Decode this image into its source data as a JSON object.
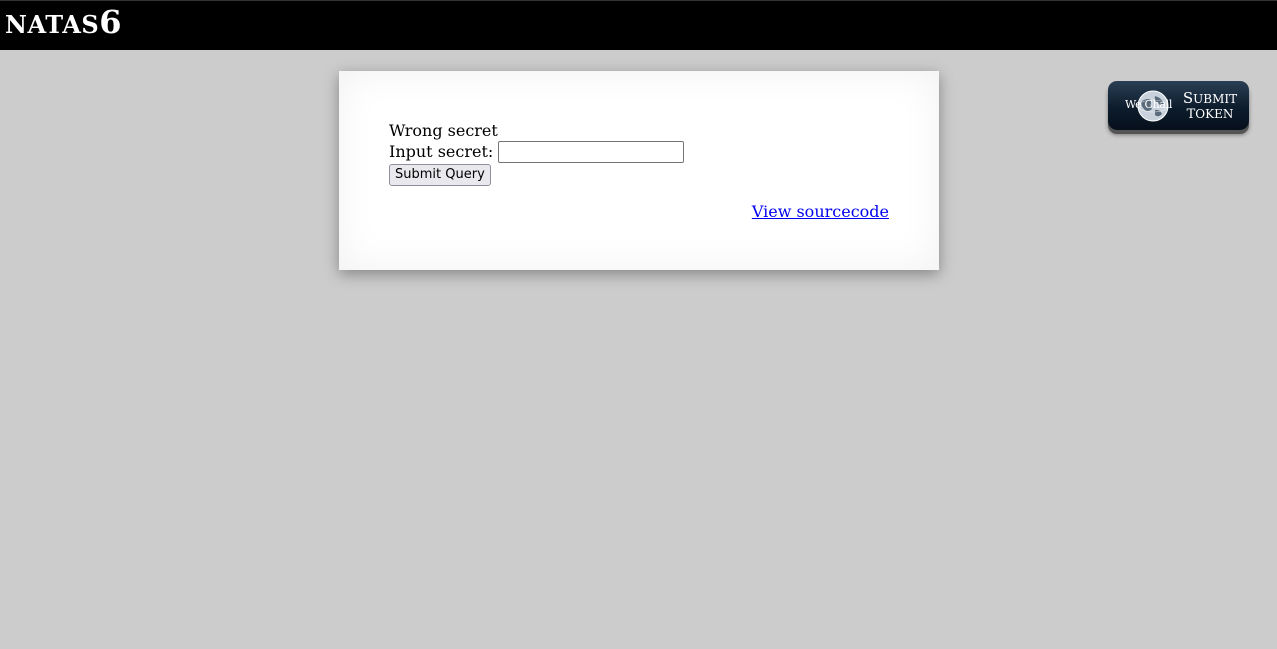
{
  "header": {
    "title_prefix": "NATAS",
    "title_number": "6"
  },
  "content": {
    "message": "Wrong secret",
    "input_label": "Input secret:",
    "input_value": "",
    "submit_label": "Submit Query",
    "source_link": "View sourcecode"
  },
  "wechall": {
    "logo_text": "We Chall",
    "line1": "Submit",
    "line2": "Token"
  },
  "colors": {
    "header_bg": "#000000",
    "page_bg": "#cccccc",
    "link": "#0000ee"
  }
}
